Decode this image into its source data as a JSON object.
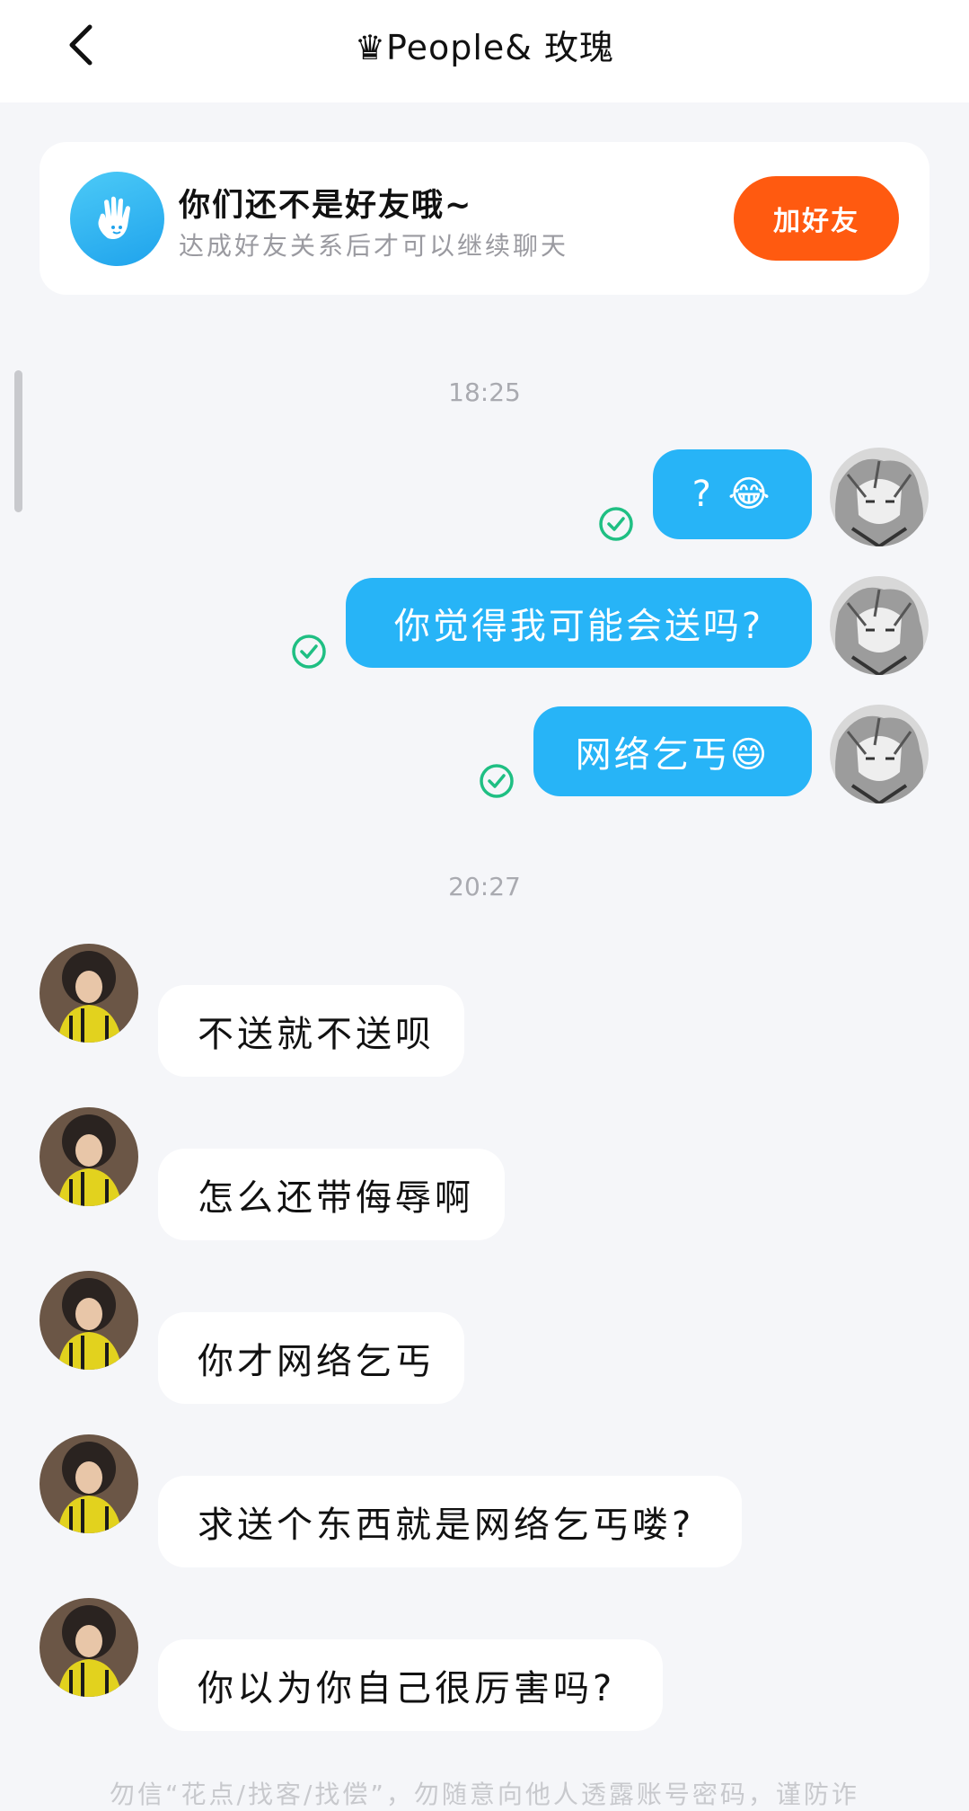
{
  "header": {
    "title": "♛People& 玫瑰"
  },
  "friend_card": {
    "title": "你们还不是好友哦~",
    "subtitle": "达成好友关系后才可以继续聊天",
    "button_label": "加好友"
  },
  "messages": {
    "time_1": "18:25",
    "time_2": "20:27",
    "me_1": "? 😂",
    "me_2": "你觉得我可能会送吗?",
    "me_3": "网络乞丐😄",
    "other_1": "不送就不送呗",
    "other_2": "怎么还带侮辱啊",
    "other_3": "你才网络乞丐",
    "other_4": "求送个东西就是网络乞丐喽?",
    "other_5": "你以为你自己很厉害吗?"
  },
  "footer": {
    "note": "勿信“花点/找客/找偿”，勿随意向他人透露账号密码，谨防诈"
  },
  "colors": {
    "accent_blue": "#27b4f7",
    "add_button": "#ff5a10",
    "check_green": "#1fbf83"
  }
}
